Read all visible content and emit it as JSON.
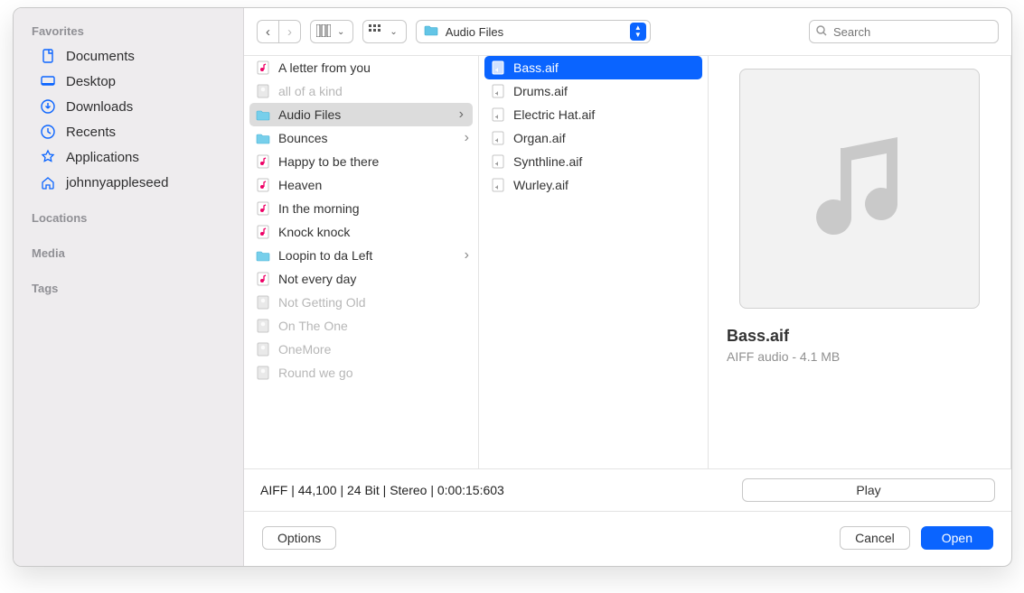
{
  "sidebar": {
    "favorites_label": "Favorites",
    "locations_label": "Locations",
    "media_label": "Media",
    "tags_label": "Tags",
    "items": [
      {
        "label": "Documents",
        "icon": "document-icon"
      },
      {
        "label": "Desktop",
        "icon": "desktop-icon"
      },
      {
        "label": "Downloads",
        "icon": "download-icon"
      },
      {
        "label": "Recents",
        "icon": "clock-icon"
      },
      {
        "label": "Applications",
        "icon": "app-icon"
      },
      {
        "label": "johnnyappleseed",
        "icon": "home-icon"
      }
    ]
  },
  "toolbar": {
    "popup_label": "Audio Files",
    "search_placeholder": "Search"
  },
  "column1": [
    {
      "label": "A letter from you",
      "type": "song",
      "dim": false,
      "folder": false
    },
    {
      "label": "all of a kind",
      "type": "proj",
      "dim": true,
      "folder": false
    },
    {
      "label": "Audio Files",
      "type": "folder",
      "dim": false,
      "folder": true,
      "selected": true
    },
    {
      "label": "Bounces",
      "type": "folder",
      "dim": false,
      "folder": true
    },
    {
      "label": "Happy to be there",
      "type": "song",
      "dim": false,
      "folder": false
    },
    {
      "label": "Heaven",
      "type": "song",
      "dim": false,
      "folder": false
    },
    {
      "label": "In the morning",
      "type": "song",
      "dim": false,
      "folder": false
    },
    {
      "label": "Knock knock",
      "type": "song",
      "dim": false,
      "folder": false
    },
    {
      "label": "Loopin to da Left",
      "type": "folder",
      "dim": false,
      "folder": true
    },
    {
      "label": "Not every day",
      "type": "song",
      "dim": false,
      "folder": false
    },
    {
      "label": "Not Getting Old",
      "type": "proj",
      "dim": true,
      "folder": false
    },
    {
      "label": "On The One",
      "type": "proj",
      "dim": true,
      "folder": false
    },
    {
      "label": "OneMore",
      "type": "proj",
      "dim": true,
      "folder": false
    },
    {
      "label": "Round we go",
      "type": "proj",
      "dim": true,
      "folder": false
    }
  ],
  "column2": [
    {
      "label": "Bass.aif",
      "selected": true
    },
    {
      "label": "Drums.aif"
    },
    {
      "label": "Electric Hat.aif"
    },
    {
      "label": "Organ.aif"
    },
    {
      "label": "Synthline.aif"
    },
    {
      "label": "Wurley.aif"
    }
  ],
  "preview": {
    "name": "Bass.aif",
    "meta": "AIFF audio - 4.1 MB"
  },
  "status": "AIFF  |  44,100  |  24 Bit  |  Stereo  |  0:00:15:603",
  "play_label": "Play",
  "footer": {
    "options_label": "Options",
    "cancel_label": "Cancel",
    "open_label": "Open"
  }
}
